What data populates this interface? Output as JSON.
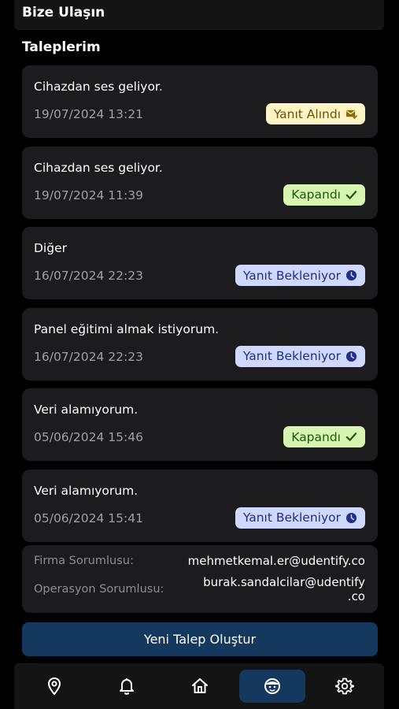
{
  "header": {
    "title": "Bize Ulaşın"
  },
  "section": {
    "title": "Taleplerim"
  },
  "requests": [
    {
      "title": "Cihazdan ses geliyor.",
      "date": "19/07/2024 13:21",
      "status": "Yanıt Alındı"
    },
    {
      "title": "Cihazdan ses geliyor.",
      "date": "19/07/2024 11:39",
      "status": "Kapandı"
    },
    {
      "title": "Diğer",
      "date": "16/07/2024 22:23",
      "status": "Yanıt Bekleniyor"
    },
    {
      "title": "Panel eğitimi almak istiyorum.",
      "date": "16/07/2024 22:23",
      "status": "Yanıt Bekleniyor"
    },
    {
      "title": "Veri alamıyorum.",
      "date": "05/06/2024 15:46",
      "status": "Kapandı"
    },
    {
      "title": "Veri alamıyorum.",
      "date": "05/06/2024 15:41",
      "status": "Yanıt Bekleniyor"
    }
  ],
  "contacts": {
    "firm_label": "Firma Sorumlusu:",
    "firm_email": "mehmetkemal.er@udentify.co",
    "ops_label": "Operasyon Sorumlusu:",
    "ops_email_line1": "burak.sandalcilar@udentify",
    "ops_email_line2": ".co"
  },
  "cta": {
    "label": "Yeni Talep Oluştur"
  },
  "nav": [
    {
      "icon": "map-pin-icon"
    },
    {
      "icon": "bell-icon"
    },
    {
      "icon": "home-icon"
    },
    {
      "icon": "support-face-icon",
      "active": true
    },
    {
      "icon": "gear-icon"
    }
  ],
  "colors": {
    "accent": "#14385e",
    "card": "#1c1c1e",
    "status_received": "#fdf3c4",
    "status_closed": "#d6f5b0",
    "status_waiting": "#cfd9ff"
  }
}
